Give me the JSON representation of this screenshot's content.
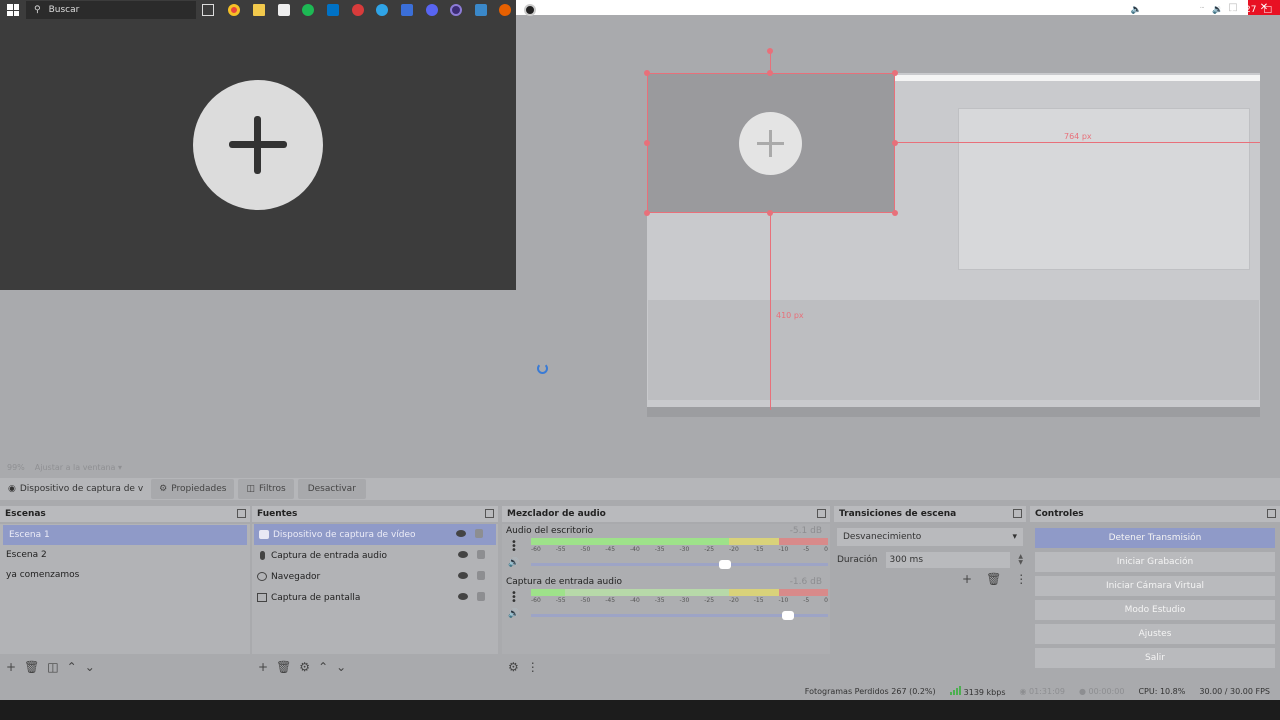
{
  "zoom": {
    "percent": "99%",
    "mode": "Ajustar a la ventana"
  },
  "context_bar": {
    "source_name": "Dispositivo de captura de v",
    "properties": "Propiedades",
    "filters": "Filtros",
    "deactivate": "Desactivar"
  },
  "preview": {
    "width_label": "764 px",
    "height_label": "410 px"
  },
  "scenes": {
    "title": "Escenas",
    "items": [
      {
        "label": "Escena 1"
      },
      {
        "label": "Escena 2"
      },
      {
        "label": "ya comenzamos"
      }
    ]
  },
  "sources": {
    "title": "Fuentes",
    "items": [
      {
        "label": "Dispositivo de captura de vídeo",
        "icon": "camera-icon"
      },
      {
        "label": "Captura de entrada audio",
        "icon": "microphone-icon"
      },
      {
        "label": "Navegador",
        "icon": "globe-icon"
      },
      {
        "label": "Captura de pantalla",
        "icon": "monitor-icon"
      }
    ]
  },
  "mixer": {
    "title": "Mezclador de audio",
    "scale": [
      "-60",
      "-55",
      "-50",
      "-45",
      "-40",
      "-35",
      "-30",
      "-25",
      "-20",
      "-15",
      "-10",
      "-5",
      "0"
    ],
    "tracks": [
      {
        "name": "Audio del escritorio",
        "db": "-5.1 dB",
        "volume": 0.66
      },
      {
        "name": "Captura de entrada audio",
        "db": "-1.6 dB",
        "volume": 0.88
      }
    ]
  },
  "transitions": {
    "title": "Transiciones de escena",
    "selected": "Desvanecimiento",
    "duration_label": "Duración",
    "duration_value": "300 ms"
  },
  "controls": {
    "title": "Controles",
    "stop_stream": "Detener Transmisión",
    "start_recording": "Iniciar Grabación",
    "start_virtual_cam": "Iniciar Cámara Virtual",
    "studio_mode": "Modo Estudio",
    "settings": "Ajustes",
    "exit": "Salir"
  },
  "status": {
    "dropped_frames": "Fotogramas Perdidos 267 (0.2%)",
    "bitrate": "3139 kbps",
    "stream_time": "01:31:09",
    "record_time": "00:00:00",
    "cpu": "CPU: 10.8%",
    "fps": "30.00 / 30.00 FPS"
  },
  "taskbar": {
    "search_placeholder": "Buscar",
    "clock": "23:27"
  },
  "colors": {
    "accent": "#8f9ac8",
    "selection": "#e8707a",
    "close": "#e81123",
    "meter_green": "#9ee28a",
    "meter_yellow": "#d9d27a",
    "meter_red": "#d88a8a"
  }
}
